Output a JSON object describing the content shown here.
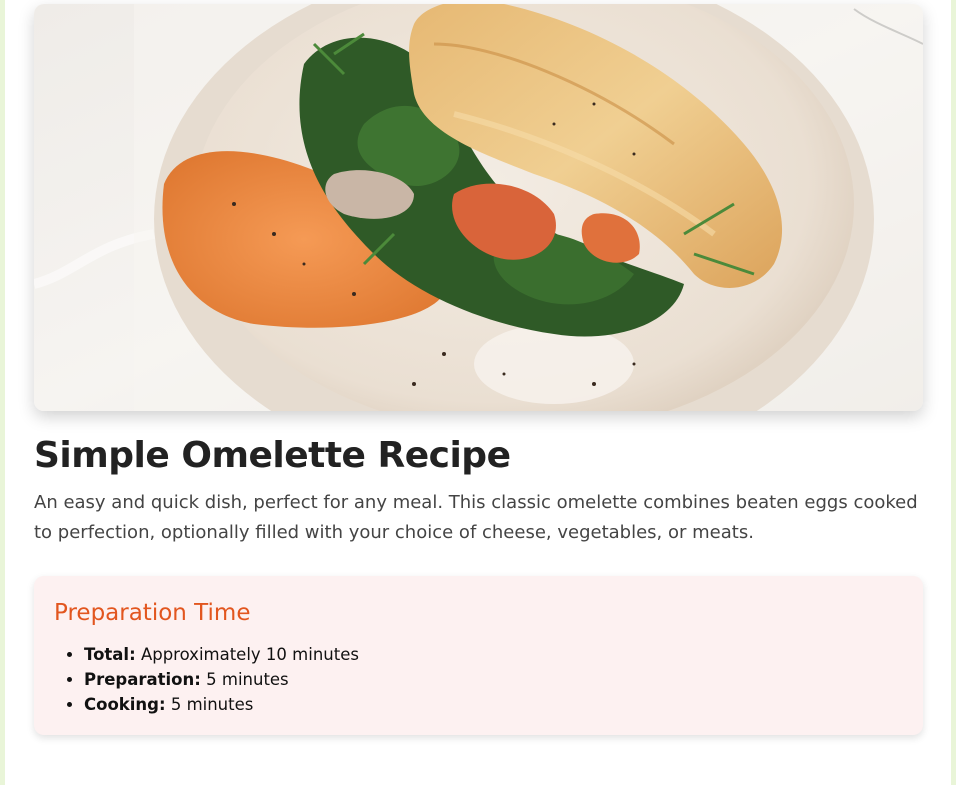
{
  "hero": {
    "image_name": "omelette-photo"
  },
  "recipe": {
    "title": "Simple Omelette Recipe",
    "description": "An easy and quick dish, perfect for any meal. This classic omelette combines beaten eggs cooked to perfection, optionally filled with your choice of cheese, vegetables, or meats."
  },
  "prep": {
    "title": "Preparation Time",
    "items": [
      {
        "label": "Total:",
        "value": "Approximately 10 minutes"
      },
      {
        "label": "Preparation:",
        "value": "5 minutes"
      },
      {
        "label": "Cooking:",
        "value": "5 minutes"
      }
    ]
  },
  "colors": {
    "accent": "#e2561f",
    "card_background": "#fdf1f1",
    "page_border": "#e9f5d8"
  }
}
